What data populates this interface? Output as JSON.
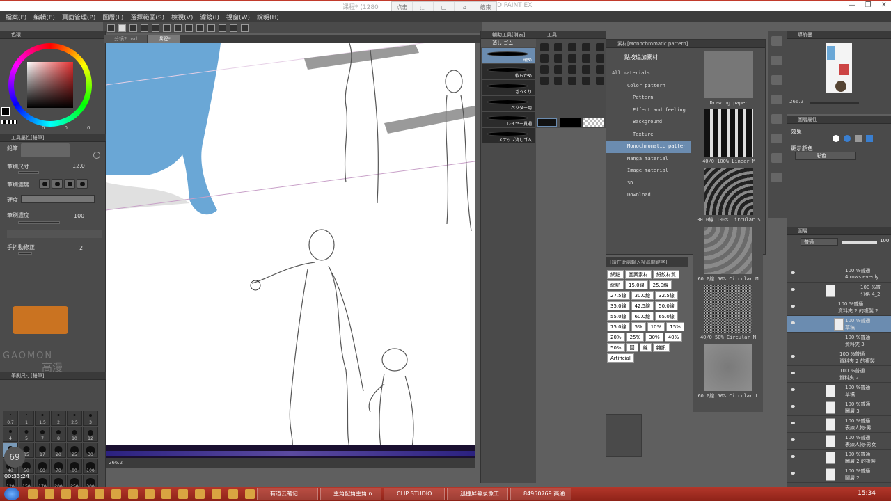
{
  "window": {
    "title": "课程* (1280",
    "title_right": "D PAINT EX"
  },
  "recorder": {
    "buttons": [
      "点击",
      "",
      "",
      "",
      "结束"
    ]
  },
  "menu": [
    "檔案(F)",
    "編輯(E)",
    "頁面管理(P)",
    "圖層(L)",
    "選擇範圍(S)",
    "檢視(V)",
    "濾鏡(I)",
    "視窗(W)",
    "說明(H)"
  ],
  "tabs": [
    "分镜2.psd",
    "课程*"
  ],
  "left": {
    "color_header": "色環",
    "color_values": [
      "0",
      "0",
      "0"
    ],
    "tool_prop_header": "工具屬性[鉛筆]",
    "brush_name": "鉛筆",
    "brush_size_label": "筆刷尺寸",
    "brush_size": "12.0",
    "hardness_label": "筆刷濃度",
    "paper_label": "硬度",
    "density_label": "筆刷濃度",
    "density": "100",
    "stabilize_label": "手抖動修正",
    "stabilize": "2",
    "brush_size_header": "筆刷尺寸[鉛筆]",
    "brush_sizes": [
      "0.7",
      "1",
      "1.5",
      "2",
      "2.5",
      "3",
      "4",
      "5",
      "7",
      "8",
      "10",
      "12",
      "12",
      "15",
      "17",
      "20",
      "25",
      "30",
      "40",
      "50",
      "60",
      "70",
      "80",
      "100",
      "120",
      "150",
      "170",
      "200",
      "250",
      "300"
    ],
    "timer": "00:33:24",
    "badge": "69"
  },
  "canvas": {
    "zoom": "266.2",
    "status": "266.2"
  },
  "subtool": {
    "header": "輔助工具[消去]",
    "tab": "消し ゴム",
    "items": [
      "硬め",
      "軟らかめ",
      "ざっくり",
      "ベクター用",
      "レイヤー貫通",
      "スナップ消しゴム"
    ]
  },
  "tools": {
    "header": "工具"
  },
  "materials": {
    "header": "素材[Monochromatic pattern]",
    "add_btn": "點按追加素材",
    "tree": [
      "All materials",
      "Color pattern",
      "Pattern",
      "Effect and feeling",
      "Background",
      "Texture",
      "Monochromatic patter",
      "Manga material",
      "Image material",
      "3D",
      "Download"
    ],
    "thumbs": [
      "Drawing paper",
      "40/0 100% Linear M",
      "30.0線 100% Circular S",
      "60.0線 50% Circular M",
      "40/0 50% Circular M",
      "60.0線 50% Circular L"
    ],
    "search_placeholder": "[請在此處輸入搜尋關鍵字]",
    "tags": [
      "網點",
      "圖案素材",
      "紙紋材質",
      "網點",
      "15.0線",
      "25.0線",
      "27.5線",
      "30.0線",
      "32.5線",
      "35.0線",
      "42.5線",
      "50.0線",
      "55.0線",
      "60.0線",
      "65.0線",
      "75.0線",
      "5%",
      "10%",
      "15%",
      "20%",
      "25%",
      "30%",
      "40%",
      "50%",
      "圓",
      "線",
      "雜訊",
      "Artificial"
    ]
  },
  "navigator": {
    "header": "導航器",
    "zoom": "266.2"
  },
  "layer_props": {
    "header": "圖層屬性",
    "effect_label": "效果",
    "display_color_label": "顯示顏色",
    "display_color": "彩色"
  },
  "layers": {
    "header": "圖層",
    "blend": "普通",
    "opacity": "100",
    "rows": [
      {
        "t1": "100 %普通",
        "t2": "4 rows evenly"
      },
      {
        "t1": "100 %普",
        "t2": "分格 4_2"
      },
      {
        "t1": "100 %普通",
        "t2": "資料夾 2 的複製 2"
      },
      {
        "t1": "100 %普通",
        "t2": "草稿"
      },
      {
        "t1": "100 %普通",
        "t2": "資料夾 3"
      },
      {
        "t1": "100 %普通",
        "t2": "資料夾 2 的複製"
      },
      {
        "t1": "100 %普通",
        "t2": "資料夾 2"
      },
      {
        "t1": "100 %普通",
        "t2": "草稿"
      },
      {
        "t1": "100 %普通",
        "t2": "圖層 3"
      },
      {
        "t1": "100 %普通",
        "t2": "表線人物-男"
      },
      {
        "t1": "100 %普通",
        "t2": "表線人物-男女"
      },
      {
        "t1": "100 %普通",
        "t2": "圖層 2 的複製"
      },
      {
        "t1": "100 %普通",
        "t2": "圖層 2"
      }
    ]
  },
  "taskbar": {
    "tasks": [
      "有道云笔记",
      "主角配角主角.n...",
      "CLIP STUDIO ...",
      "迅捷屏幕录像工...",
      "84950769 高通..."
    ],
    "clock": "15:34"
  },
  "colors": {
    "accent": "#6b8cb0",
    "taskbar": "#a32a1e",
    "horse": "#6aa7d6"
  }
}
